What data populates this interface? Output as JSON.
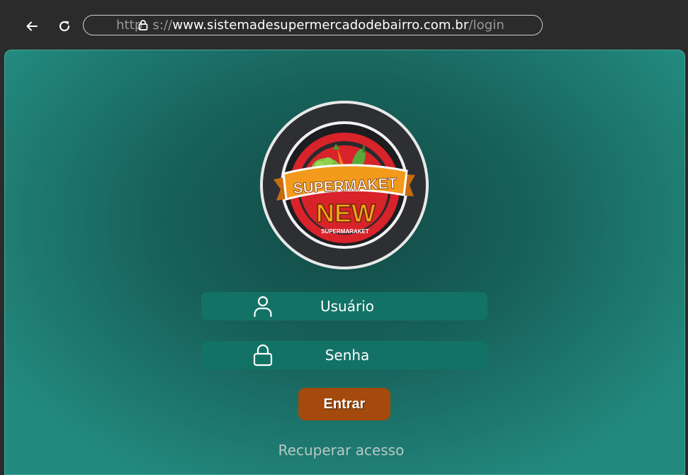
{
  "browser": {
    "url_scheme": "http",
    "url_scheme_tail": "s://",
    "url_host": "www.sistemadesupermercadodebairro.com.br",
    "url_path": "/login",
    "back_icon": "arrow-left-icon",
    "reload_icon": "reload-icon",
    "lock_icon": "lock-icon"
  },
  "logo": {
    "banner_text": "SUPERMAKET",
    "main_text": "NEW",
    "sub_text": "SUPERMARAKET"
  },
  "login": {
    "username_placeholder": "Usuário",
    "username_icon": "user-icon",
    "password_placeholder": "Senha",
    "password_icon": "lock-icon",
    "submit_label": "Entrar",
    "recover_label": "Recuperar acesso"
  },
  "colors": {
    "background_center": "#124a45",
    "background_edge": "#238a7f",
    "field": "#137266",
    "button": "#a34a0c",
    "logo_banner": "#f39a1d",
    "logo_ring": "#d8232a"
  }
}
